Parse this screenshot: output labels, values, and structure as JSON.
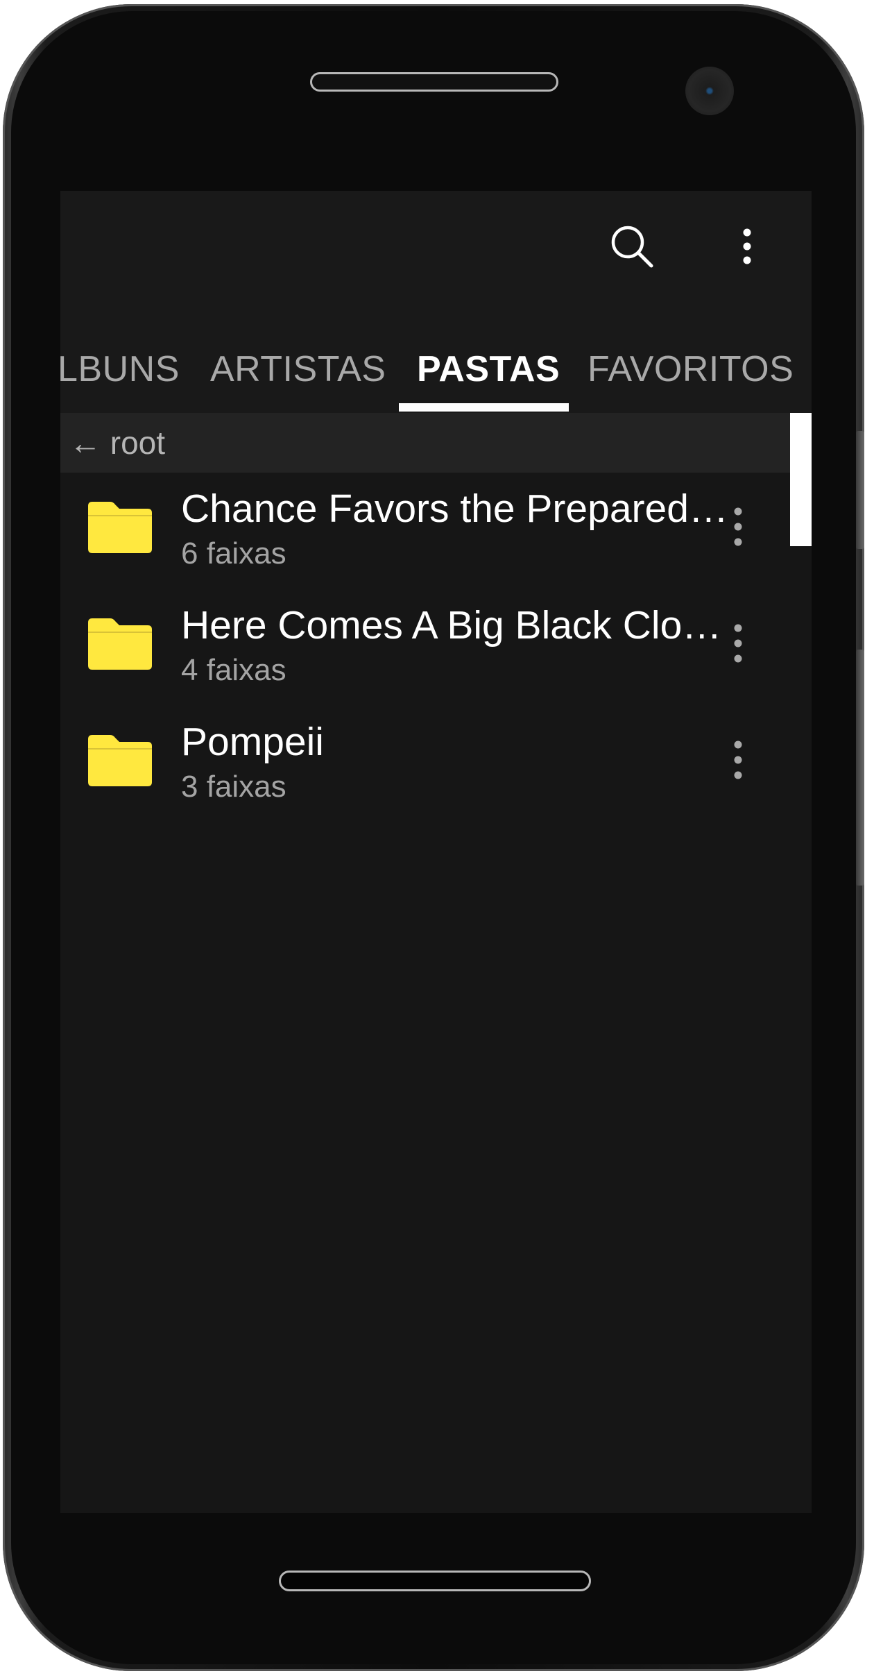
{
  "toolbar": {
    "search_icon": "search-icon",
    "more_icon": "more-vertical-icon"
  },
  "tabs": [
    {
      "label": "LBUNS",
      "active": false
    },
    {
      "label": "ARTISTAS",
      "active": false
    },
    {
      "label": "PASTAS",
      "active": true
    },
    {
      "label": "FAVORITOS",
      "active": false
    }
  ],
  "breadcrumb": {
    "label": "← root"
  },
  "folders": [
    {
      "title": "Chance Favors the Prepared…",
      "subtitle": "6 faixas",
      "icon": "folder-icon"
    },
    {
      "title": "Here Comes A Big Black Clo…",
      "subtitle": "4 faixas",
      "icon": "folder-icon"
    },
    {
      "title": "Pompeii",
      "subtitle": "3 faixas",
      "icon": "folder-icon"
    }
  ],
  "colors": {
    "background": "#161616",
    "appbar": "#191919",
    "breadcrumb_bar": "#232323",
    "folder": "#ffe83f",
    "tab_active": "#ffffff",
    "tab_inactive": "#a9a9a9",
    "subtitle": "#a4a4a4"
  }
}
